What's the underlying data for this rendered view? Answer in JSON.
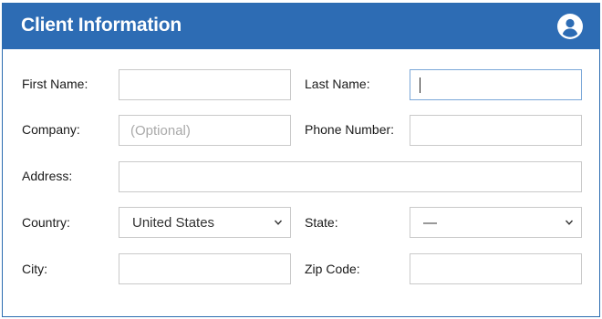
{
  "header": {
    "title": "Client Information",
    "background_color": "#2d6cb4",
    "user_icon": "user-circle-icon"
  },
  "form": {
    "first_name": {
      "label": "First Name:",
      "value": ""
    },
    "last_name": {
      "label": "Last Name:",
      "value": "",
      "focused": true
    },
    "company": {
      "label": "Company:",
      "value": "",
      "placeholder": "(Optional)"
    },
    "phone": {
      "label": "Phone Number:",
      "value": ""
    },
    "address": {
      "label": "Address:",
      "value": ""
    },
    "country": {
      "label": "Country:",
      "selected": "United States"
    },
    "state": {
      "label": "State:",
      "selected": "—"
    },
    "city": {
      "label": "City:",
      "value": ""
    },
    "zip": {
      "label": "Zip Code:",
      "value": ""
    }
  }
}
